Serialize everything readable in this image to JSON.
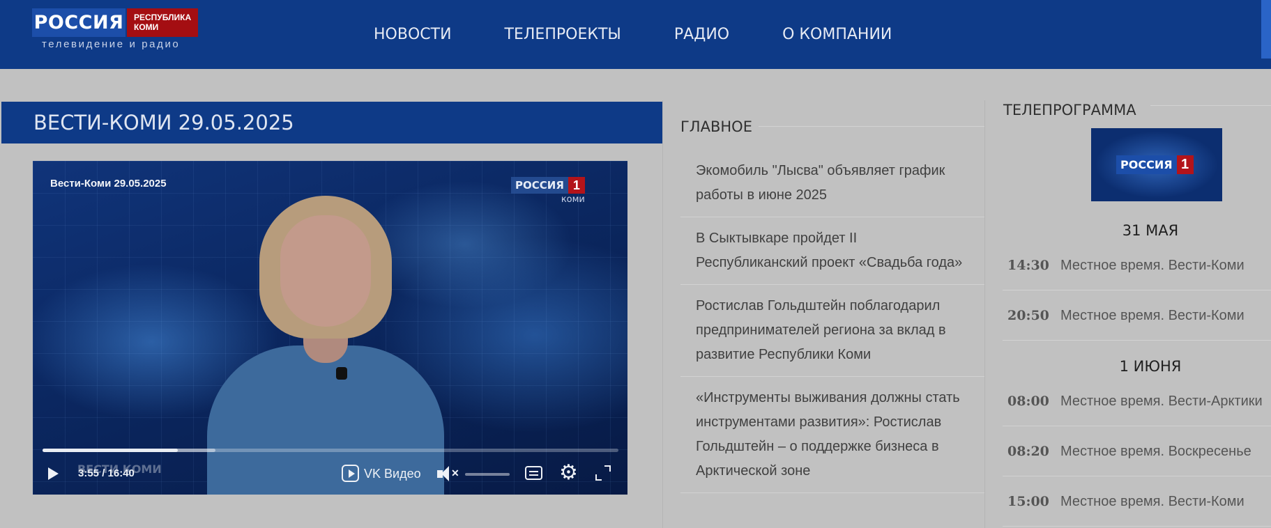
{
  "header": {
    "logo": {
      "name": "РОССИЯ",
      "region_line1": "РЕСПУБЛИКА",
      "region_line2": "КОМИ",
      "tagline": "телевидение и радио"
    },
    "nav": [
      "НОВОСТИ",
      "ТЕЛЕПРОЕКТЫ",
      "РАДИО",
      "О КОМПАНИИ"
    ]
  },
  "page_title": "ВЕСТИ-КОМИ 29.05.2025",
  "video": {
    "caption": "Вести-Коми 29.05.2025",
    "channel_badge": {
      "name": "РОССИЯ",
      "number": "1",
      "region": "коми"
    },
    "lower_third": "ВЕСТИ КОМИ",
    "time": "3:55 / 16:40",
    "progress_played": 0.235,
    "progress_buffered": 0.3,
    "provider_label": "VK Видео"
  },
  "main_news": {
    "heading": "ГЛАВНОЕ",
    "items": [
      "Экомобиль \"Лысва\" объявляет график работы в июне 2025",
      "В Сыктывкаре пройдет II Республиканский проект «Свадьба года»",
      "Ростислав Гольдштейн поблагодарил предпринимателей региона за вклад в развитие Республики Коми",
      "«Инструменты выживания должны стать инструментами развития»: Ростислав Гольдштейн – о поддержке бизнеса в Арктической зоне"
    ]
  },
  "tv_program": {
    "heading": "ТЕЛЕПРОГРАММА",
    "channel_logo": {
      "name": "РОССИЯ",
      "number": "1"
    },
    "days": [
      {
        "label": "31 МАЯ",
        "items": [
          {
            "time": "14:30",
            "title": "Местное время. Вести-Коми"
          },
          {
            "time": "20:50",
            "title": "Местное время. Вести-Коми"
          }
        ]
      },
      {
        "label": "1 ИЮНЯ",
        "items": [
          {
            "time": "08:00",
            "title": "Местное время. Вести-Арктики"
          },
          {
            "time": "08:20",
            "title": "Местное время. Воскресенье"
          },
          {
            "time": "15:00",
            "title": "Местное время. Вести-Коми"
          }
        ]
      }
    ]
  },
  "colors": {
    "header_bg": "#0e3a87",
    "brand_red": "#a40e12",
    "page_bg": "#c1c1c1"
  }
}
